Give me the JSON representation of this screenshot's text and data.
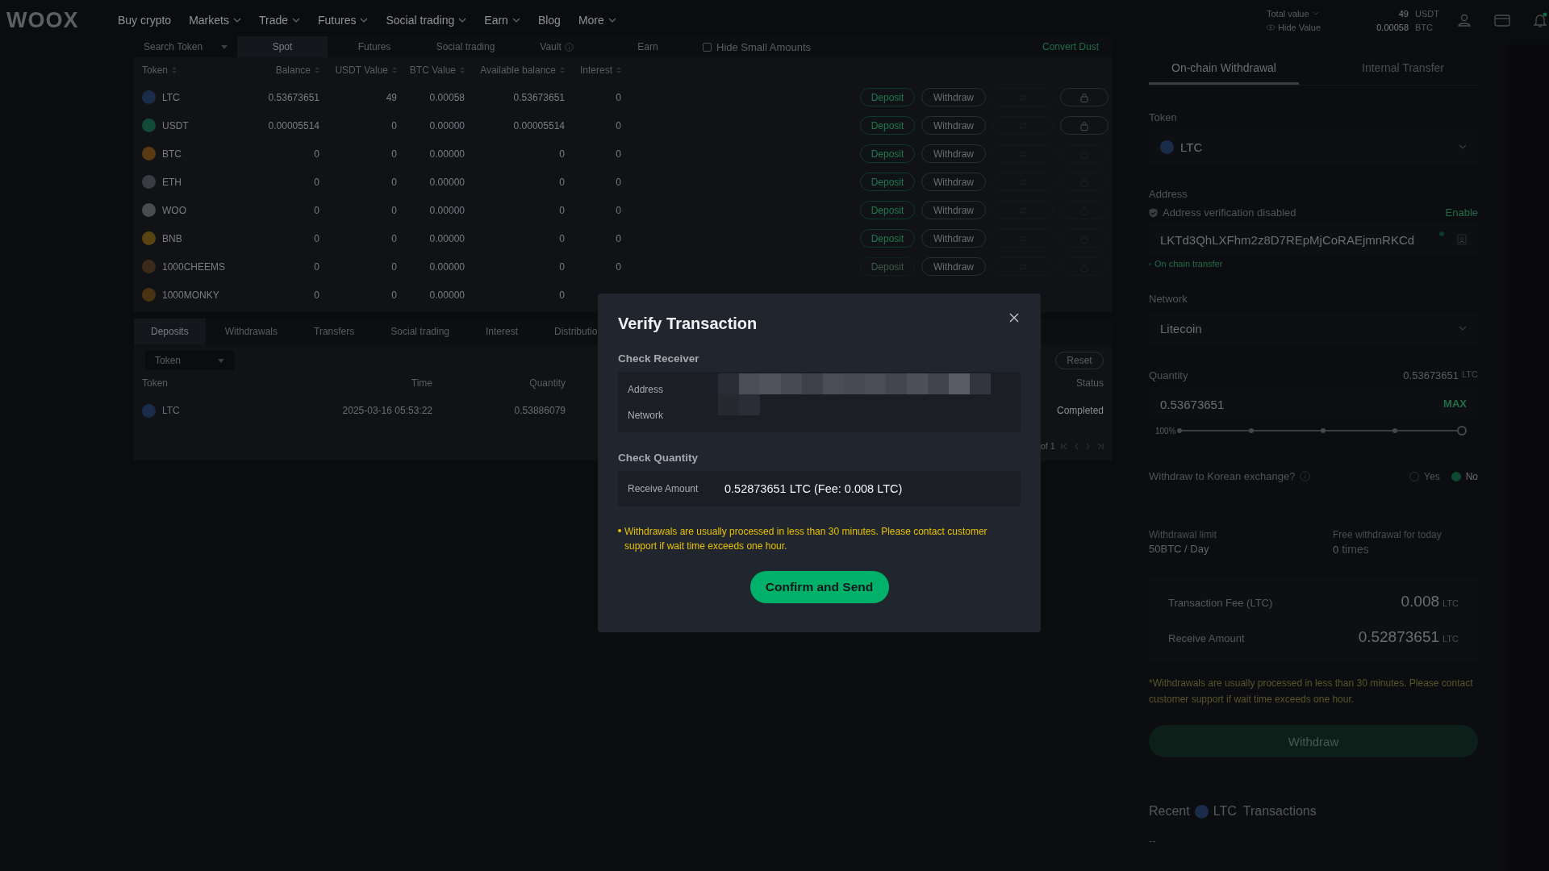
{
  "nav": {
    "logo": "WOOX",
    "items": [
      {
        "label": "Buy crypto",
        "dropdown": false
      },
      {
        "label": "Markets",
        "dropdown": true
      },
      {
        "label": "Trade",
        "dropdown": true
      },
      {
        "label": "Futures",
        "dropdown": true
      },
      {
        "label": "Social trading",
        "dropdown": true
      },
      {
        "label": "Earn",
        "dropdown": true
      },
      {
        "label": "Blog",
        "dropdown": false
      },
      {
        "label": "More",
        "dropdown": true
      }
    ],
    "total": {
      "label": "Total value",
      "usdt": "49",
      "usdt_unit": "USDT",
      "hide_label": "Hide Value",
      "btc": "0.00058",
      "btc_unit": "BTC"
    }
  },
  "assets": {
    "search_placeholder": "Search Token",
    "tabs": [
      {
        "label": "Spot",
        "selected": true,
        "info": false
      },
      {
        "label": "Futures",
        "selected": false,
        "info": false
      },
      {
        "label": "Social trading",
        "selected": false,
        "info": false
      },
      {
        "label": "Vault",
        "selected": false,
        "info": true
      },
      {
        "label": "Earn",
        "selected": false,
        "info": false
      }
    ],
    "hide_small": {
      "label": "Hide Small Amounts",
      "checked": false
    },
    "convert_dust": "Convert Dust",
    "columns": [
      "Token",
      "Balance",
      "USDT Value",
      "BTC Value",
      "Available balance",
      "Interest"
    ],
    "rows": [
      {
        "token": "LTC",
        "color": "#1b2c4a",
        "balance": "0.53673651",
        "usdt_value": "49",
        "btc_value": "0.00058",
        "available": "0.53673651",
        "interest": "0",
        "deposit": "Deposit",
        "deposit_disabled": false,
        "withdraw": "Withdraw",
        "lock_active": true
      },
      {
        "token": "USDT",
        "color": "#124a38",
        "balance": "0.00005514",
        "usdt_value": "0",
        "btc_value": "0.00000",
        "available": "0.00005514",
        "interest": "0",
        "deposit": "Deposit",
        "deposit_disabled": false,
        "withdraw": "Withdraw",
        "lock_active": true
      },
      {
        "token": "BTC",
        "color": "#5a3a12",
        "balance": "0",
        "usdt_value": "0",
        "btc_value": "0.00000",
        "available": "0",
        "interest": "0",
        "deposit": "Deposit",
        "deposit_disabled": false,
        "withdraw": "Withdraw",
        "lock_active": false
      },
      {
        "token": "ETH",
        "color": "#3a3c42",
        "balance": "0",
        "usdt_value": "0",
        "btc_value": "0.00000",
        "available": "0",
        "interest": "0",
        "deposit": "Deposit",
        "deposit_disabled": false,
        "withdraw": "Withdraw",
        "lock_active": false
      },
      {
        "token": "WOO",
        "color": "#4a4c50",
        "balance": "0",
        "usdt_value": "0",
        "btc_value": "0.00000",
        "available": "0",
        "interest": "0",
        "deposit": "Deposit",
        "deposit_disabled": false,
        "withdraw": "Withdraw",
        "lock_active": false
      },
      {
        "token": "BNB",
        "color": "#5a4412",
        "balance": "0",
        "usdt_value": "0",
        "btc_value": "0.00000",
        "available": "0",
        "interest": "0",
        "deposit": "Deposit",
        "deposit_disabled": false,
        "withdraw": "Withdraw",
        "lock_active": false
      },
      {
        "token": "1000CHEEMS",
        "color": "#3a2a1a",
        "balance": "0",
        "usdt_value": "0",
        "btc_value": "0.00000",
        "available": "0",
        "interest": "0",
        "deposit": "Deposit",
        "deposit_disabled": true,
        "withdraw": "Withdraw",
        "lock_active": false
      },
      {
        "token": "1000MONKY",
        "color": "#4a3212",
        "balance": "0",
        "usdt_value": "0",
        "btc_value": "0.00000",
        "available": "0"
      }
    ]
  },
  "history": {
    "tabs": [
      {
        "label": "Deposits",
        "selected": true
      },
      {
        "label": "Withdrawals",
        "selected": false
      },
      {
        "label": "Transfers",
        "selected": false
      },
      {
        "label": "Social trading",
        "selected": false
      },
      {
        "label": "Interest",
        "selected": false
      },
      {
        "label": "Distributio",
        "selected": false
      }
    ],
    "token_placeholder": "Token",
    "reset": "Reset",
    "columns": [
      "Token",
      "Time",
      "Quantity",
      "Status"
    ],
    "rows": [
      {
        "token": "LTC",
        "color": "#1b2c4a",
        "time": "2025-03-16 05:53:22",
        "quantity": "0.53886079",
        "status": "Completed"
      }
    ],
    "pagination": "of 1"
  },
  "withdraw_panel": {
    "tabs": [
      {
        "label": "On-chain Withdrawal",
        "selected": true
      },
      {
        "label": "Internal Transfer",
        "selected": false
      }
    ],
    "token_label": "Token",
    "token": "LTC",
    "address_label": "Address",
    "verification": "Address verification disabled",
    "enable": "Enable",
    "address": "LKTd3QhLXFhm2z8D7REpMjCoRAEjmnRKCd",
    "address_note": "On chain transfer",
    "network_label": "Network",
    "network": "Litecoin",
    "quantity_label": "Quantity",
    "available": "0.53673651",
    "available_unit": "LTC",
    "quantity": "0.53673651",
    "max": "MAX",
    "slider": {
      "reading": "100%",
      "level": 1
    },
    "korean_question": "Withdraw to Korean exchange?",
    "korean_options": [
      {
        "label": "Yes",
        "selected": false
      },
      {
        "label": "No",
        "selected": true
      }
    ],
    "limit_label": "Withdrawal limit",
    "limit": "50BTC / Day",
    "free_label": "Free withdrawal for today",
    "free_count": "0",
    "free_unit": "times",
    "fee_label": "Transaction Fee (LTC)",
    "fee": "0.008",
    "fee_unit": "LTC",
    "receive_label": "Receive Amount",
    "receive": "0.52873651",
    "receive_unit": "LTC",
    "notice": "*Withdrawals are usually processed in less than 30 minutes. Please contact customer support if wait time exceeds one hour.",
    "withdraw_button": "Withdraw",
    "recent": {
      "prefix": "Recent",
      "token": "LTC",
      "suffix": "Transactions",
      "empty": "--"
    }
  },
  "modal": {
    "title": "Verify Transaction",
    "receiver_heading": "Check Receiver",
    "address_label": "Address",
    "network_label": "Network",
    "quantity_heading": "Check Quantity",
    "receive_label": "Receive Amount",
    "receive_value": "0.52873651 LTC (Fee: 0.008 LTC)",
    "notice": "Withdrawals are usually processed in less than 30 minutes. Please contact customer support if wait time exceeds one hour.",
    "confirm": "Confirm and Send"
  }
}
